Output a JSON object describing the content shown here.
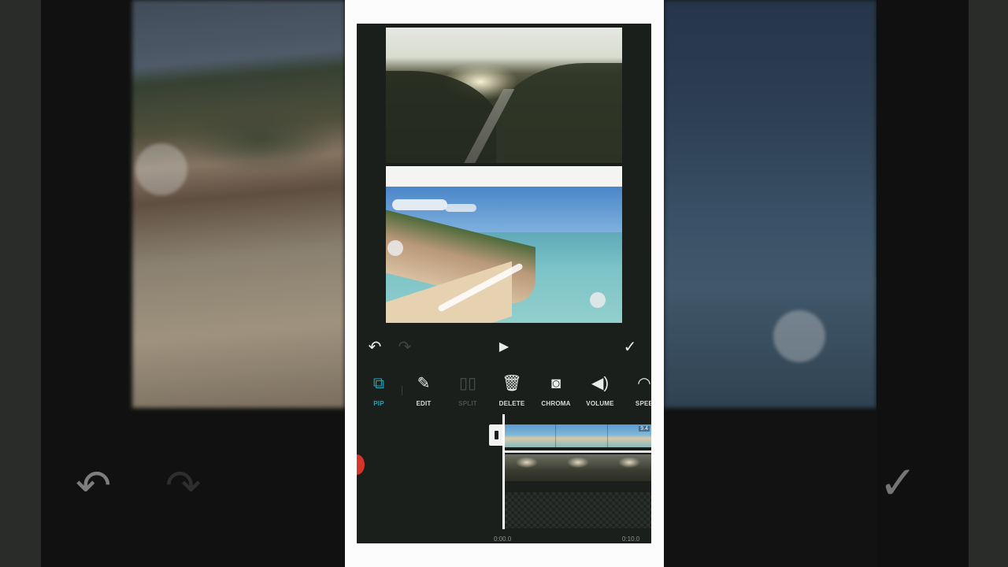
{
  "toolbar": {
    "tools": [
      {
        "label": "PIP",
        "icon": "pip-add-icon",
        "state": "active"
      },
      {
        "label": "EDIT",
        "icon": "pencil-icon",
        "state": "enabled"
      },
      {
        "label": "SPLIT",
        "icon": "split-icon",
        "state": "disabled"
      },
      {
        "label": "DELETE",
        "icon": "trash-icon",
        "state": "enabled"
      },
      {
        "label": "CHROMA",
        "icon": "chroma-icon",
        "state": "enabled"
      },
      {
        "label": "VOLUME",
        "icon": "volume-icon",
        "state": "enabled"
      },
      {
        "label": "SPEE",
        "icon": "speed-icon",
        "state": "enabled"
      }
    ]
  },
  "timeline": {
    "clip_duration": "9.4",
    "start_time": "0:00.0",
    "end_time": "0:10.0"
  },
  "colors": {
    "accent": "#18a8bf",
    "app_background": "#1b1f1c",
    "record_dot": "#d5342b"
  }
}
